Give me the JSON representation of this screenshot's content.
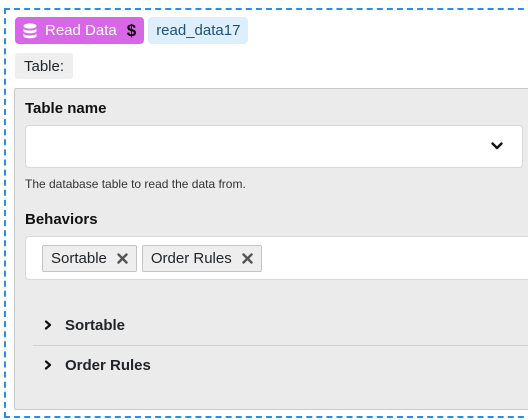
{
  "block": {
    "title": "Read Data",
    "icon": "database-icon",
    "type_icon": "dollar-icon",
    "type_symbol": "$",
    "color": "#d867e8",
    "id": "read_data17"
  },
  "section_label": "Table:",
  "table_name": {
    "label": "Table name",
    "value": "",
    "help": "The database table to read the data from."
  },
  "behaviors": {
    "label": "Behaviors",
    "chips": [
      {
        "label": "Sortable"
      },
      {
        "label": "Order Rules"
      }
    ]
  },
  "accordion": [
    {
      "label": "Sortable"
    },
    {
      "label": "Order Rules"
    }
  ]
}
